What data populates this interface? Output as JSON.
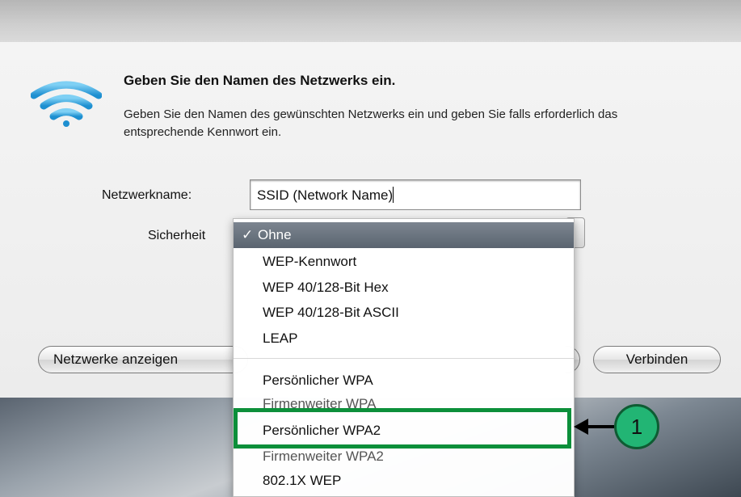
{
  "dialog": {
    "heading": "Geben Sie den Namen des Netzwerks ein.",
    "description": "Geben Sie den Namen des gewünschten Netzwerks ein und geben Sie falls erforderlich das entsprechende Kennwort ein.",
    "network_name_label": "Netzwerkname:",
    "network_name_value": "SSID (Network Name)",
    "security_label": "Sicherheit",
    "show_networks_button": "Netzwerke anzeigen",
    "connect_button": "Verbinden"
  },
  "security_menu": {
    "selected_check": "✓",
    "items": [
      "Ohne",
      "WEP-Kennwort",
      "WEP 40/128-Bit Hex",
      "WEP 40/128-Bit ASCII",
      "LEAP",
      "Persönlicher WPA",
      "Firmenweiter WPA",
      "Persönlicher WPA2",
      "Firmenweiter WPA2",
      "802.1X WEP"
    ]
  },
  "annotation": {
    "callout_number": "1",
    "color": "#0c8f3a"
  },
  "icons": {
    "wifi": "wifi-icon",
    "check": "checkmark-icon"
  }
}
